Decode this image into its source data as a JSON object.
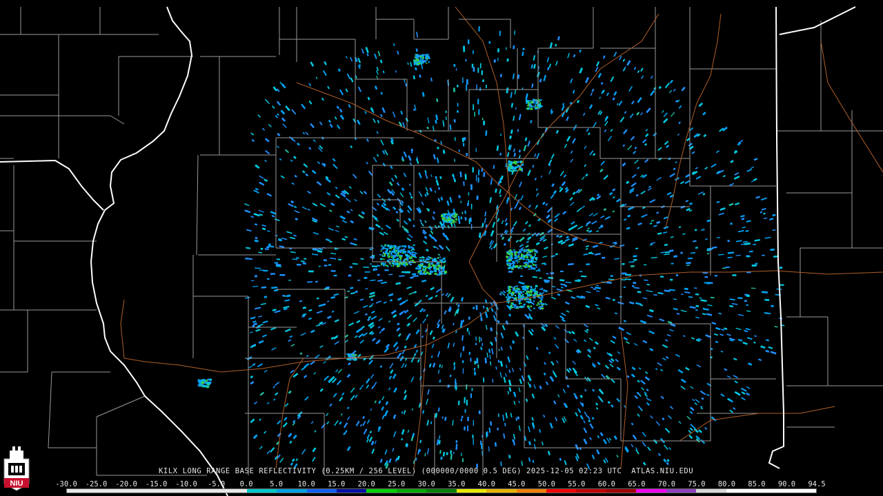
{
  "radar": {
    "caption": "KILX LONG RANGE BASE REFLECTIVITY (0.25KM / 256 LEVEL) (000000/0000 0.5 DEG) 2025-12-05 02:23 UTC  ATLAS.NIU.EDU"
  },
  "legend": {
    "labels": [
      "-30.0",
      "-25.0",
      "-20.0",
      "-15.0",
      "-10.0",
      "-5.0",
      "0.0",
      "5.0",
      "10.0",
      "15.0",
      "20.0",
      "25.0",
      "30.0",
      "35.0",
      "40.0",
      "45.0",
      "50.0",
      "55.0",
      "60.0",
      "65.0",
      "70.0",
      "75.0",
      "80.0",
      "85.0",
      "90.0",
      "94.5"
    ],
    "colors": [
      "#e8e8e8",
      "#e8e8e8",
      "#e8e8e8",
      "#e8e8e8",
      "#e8e8e8",
      "#e8e8e8",
      "#00c8c8",
      "#00a0e0",
      "#1060f0",
      "#0010a0",
      "#00d000",
      "#00a800",
      "#008000",
      "#e8e800",
      "#e8b400",
      "#f08000",
      "#f00000",
      "#c00000",
      "#a00000",
      "#f000f0",
      "#9040c0",
      "#d8d8d8",
      "#ffffff",
      "#ffffff",
      "#ffffff"
    ]
  },
  "logo": {
    "text": "NIU",
    "color": "#c8102e"
  },
  "map": {
    "state_border_color": "#ffffff",
    "county_border_color": "#9a9a9a",
    "highway_color": "#b0602a",
    "echo_colors": [
      "#00c8e0",
      "#00a0f0",
      "#1e90ff",
      "#20c0a0",
      "#40d040"
    ],
    "radar_site": "KILX"
  }
}
